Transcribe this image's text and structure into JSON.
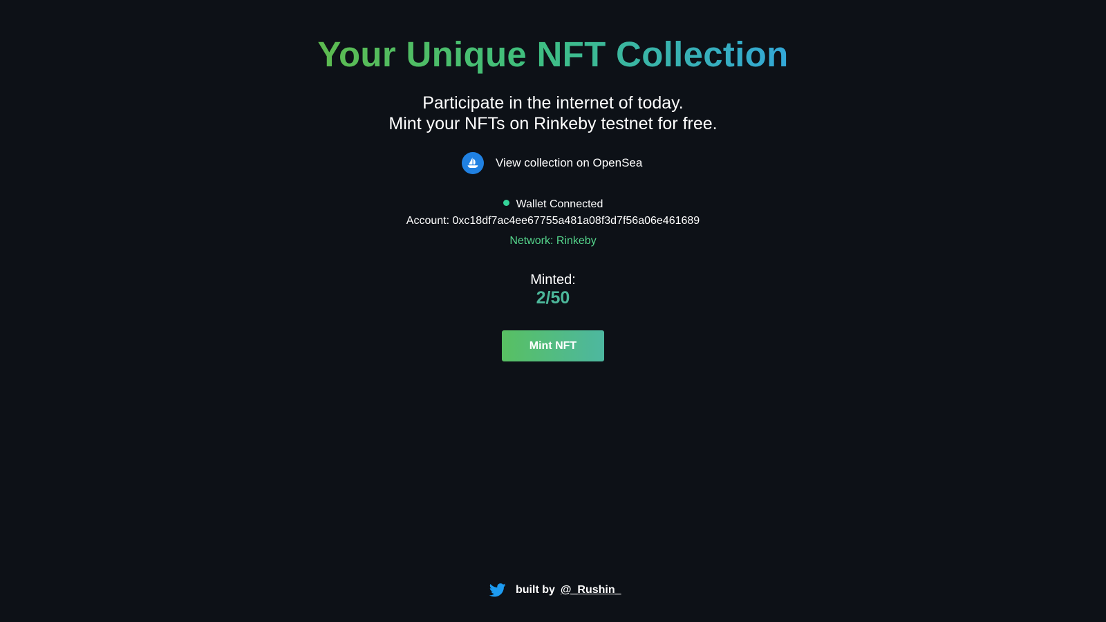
{
  "header": {
    "title": "Your Unique NFT Collection",
    "subtitle_line1": "Participate in the internet of today.",
    "subtitle_line2": "Mint your NFTs on Rinkeby testnet for free."
  },
  "opensea": {
    "icon": "opensea-icon",
    "label": "View collection on OpenSea"
  },
  "wallet": {
    "status": "Wallet Connected",
    "status_color": "#34d399",
    "account": "Account: 0xc18df7ac4ee67755a481a08f3d7f56a06e461689",
    "network": "Network: Rinkeby"
  },
  "mint": {
    "label": "Minted:",
    "count": "2/50",
    "button_label": "Mint NFT"
  },
  "footer": {
    "icon": "twitter-icon",
    "built_by": "built by",
    "handle": "@_Rushin_"
  },
  "colors": {
    "background": "#0d1117",
    "title_gradient_start": "#5dbb4f",
    "title_gradient_end": "#33a8d8",
    "opensea_blue": "#2081e2",
    "twitter_blue": "#1d9bf0",
    "accent_green": "#4cb79a"
  }
}
